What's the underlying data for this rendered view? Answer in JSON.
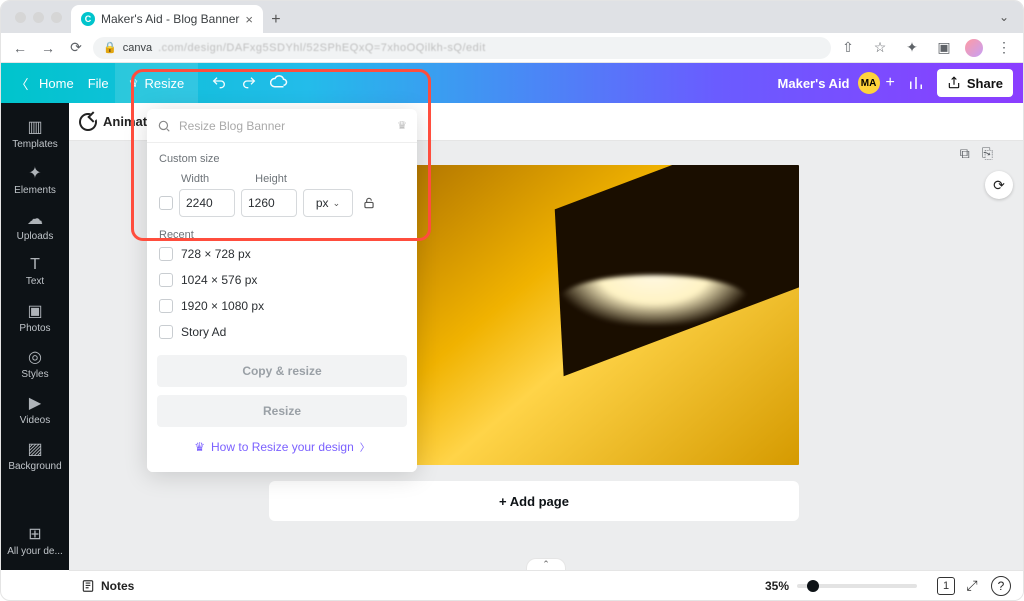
{
  "browser": {
    "tab_title": "Maker's Aid - Blog Banner",
    "favicon_letter": "C",
    "url_host": "canva",
    "url_blur": ".com/design/DAFxg5SDYhl/52SPhEQxQ=7xhoOQilkh-sQ/edit"
  },
  "editorbar": {
    "home": "Home",
    "file": "File",
    "resize": "Resize",
    "project_name": "Maker's Aid",
    "avatar_initials": "MA",
    "share": "Share"
  },
  "toolbar2": {
    "animate": "Animate"
  },
  "sidebar": {
    "items": [
      {
        "icon": "▥",
        "label": "Templates"
      },
      {
        "icon": "✦",
        "label": "Elements"
      },
      {
        "icon": "☁",
        "label": "Uploads"
      },
      {
        "icon": "T",
        "label": "Text"
      },
      {
        "icon": "▣",
        "label": "Photos"
      },
      {
        "icon": "◎",
        "label": "Styles"
      },
      {
        "icon": "▶",
        "label": "Videos"
      },
      {
        "icon": "▨",
        "label": "Background"
      },
      {
        "icon": "⊞",
        "label": "All your de..."
      }
    ]
  },
  "resize_panel": {
    "search_placeholder": "Resize Blog Banner",
    "custom_size_label": "Custom size",
    "width_label": "Width",
    "height_label": "Height",
    "width_value": "2240",
    "height_value": "1260",
    "unit": "px",
    "recent_label": "Recent",
    "recent": [
      "728 × 728 px",
      "1024 × 576 px",
      "1920 × 1080 px",
      "Story Ad"
    ],
    "copy_resize": "Copy & resize",
    "resize_btn": "Resize",
    "help_text": "How to Resize your design"
  },
  "canvas": {
    "add_page": "+ Add page"
  },
  "bottombar": {
    "notes": "Notes",
    "zoom": "35%",
    "page_indicator": "1"
  }
}
